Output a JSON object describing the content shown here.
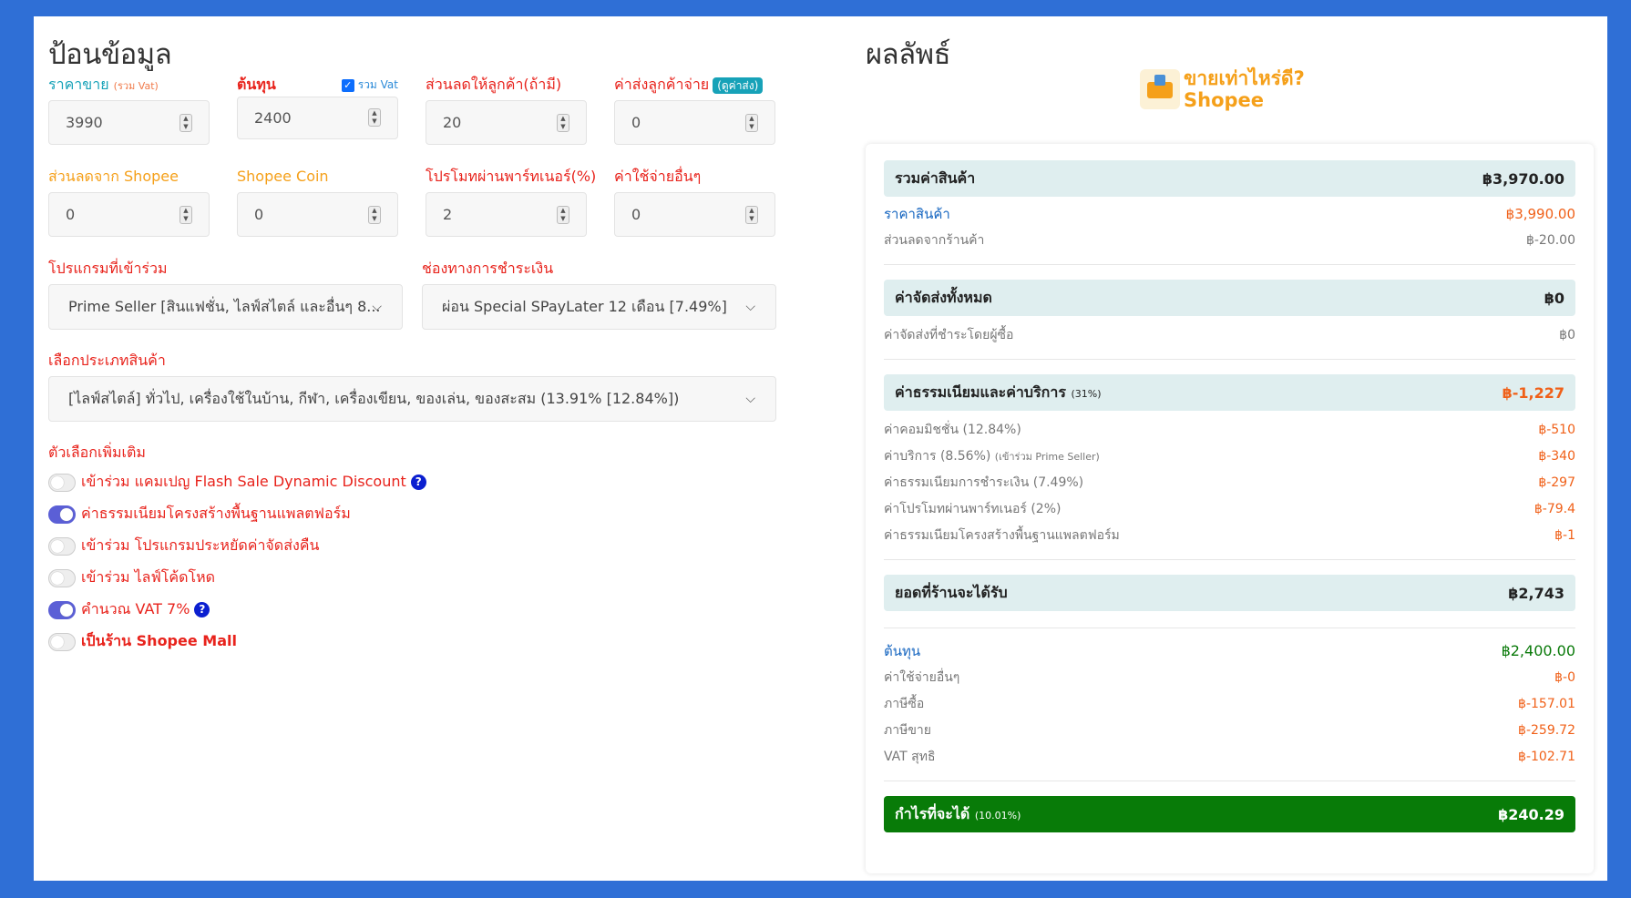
{
  "input": {
    "title": "ป้อนข้อมูล",
    "fields_row1": [
      {
        "label": "ราคาขาย",
        "note": "(รวม Vat)",
        "value": "3990"
      },
      {
        "label": "ต้นทุน",
        "checkbox_label": "รวม Vat",
        "value": "2400"
      },
      {
        "label": "ส่วนลดให้ลูกค้า(ถ้ามี)",
        "value": "20"
      },
      {
        "label": "ค่าส่งลูกค้าจ่าย",
        "pill": "(ดูค่าส่ง)",
        "value": "0"
      }
    ],
    "fields_row2": [
      {
        "label": "ส่วนลดจาก Shopee",
        "value": "0"
      },
      {
        "label": "Shopee Coin",
        "value": "0"
      },
      {
        "label": "โปรโมทผ่านพาร์ทเนอร์(%)",
        "value": "2"
      },
      {
        "label": "ค่าใช้จ่ายอื่นๆ",
        "value": "0"
      }
    ],
    "program": {
      "label": "โปรแกรมที่เข้าร่วม",
      "value": "Prime Seller [สินแฟชั่น, ไลฟ์สไตล์ และอื่นๆ 8..."
    },
    "payment": {
      "label": "ช่องทางการชำระเงิน",
      "value": "ผ่อน Special SPayLater 12 เดือน [7.49%]"
    },
    "category": {
      "label": "เลือกประเภทสินค้า",
      "value": "[ไลฟ์สไตล์] ทั่วไป, เครื่องใช้ในบ้าน, กีฬา, เครื่องเขียน, ของเล่น, ของสะสม (13.91% [12.84%])"
    },
    "options_title": "ตัวเลือกเพิ่มเติม",
    "options": [
      {
        "label": "เข้าร่วม แคมเปญ Flash Sale Dynamic Discount",
        "on": false,
        "help": true
      },
      {
        "label": "ค่าธรรมเนียมโครงสร้างพื้นฐานแพลตฟอร์ม",
        "on": true,
        "help": false
      },
      {
        "label": "เข้าร่วม โปรแกรมประหยัดค่าจัดส่งคืน",
        "on": false,
        "help": false
      },
      {
        "label": "เข้าร่วม ไลฟ์โค้ดโหด",
        "on": false,
        "help": false
      },
      {
        "label": "คำนวณ VAT 7%",
        "on": true,
        "help": true
      },
      {
        "label": "เป็นร้าน Shopee Mall",
        "on": false,
        "help": false
      }
    ]
  },
  "result": {
    "title": "ผลลัพธ์",
    "brand_line1": "ขายเท่าไหร่ดี?",
    "brand_line2": "Shopee",
    "total_products": {
      "label": "รวมค่าสินค้า",
      "value": "฿3,970.00"
    },
    "price": {
      "label": "ราคาสินค้า",
      "value": "฿3,990.00"
    },
    "shop_discount": {
      "label": "ส่วนลดจากร้านค้า",
      "value": "฿-20.00"
    },
    "shipping_total": {
      "label": "ค่าจัดส่งทั้งหมด",
      "value": "฿0"
    },
    "shipping_buyer": {
      "label": "ค่าจัดส่งที่ชำระโดยผู้ซื้อ",
      "value": "฿0"
    },
    "fees": {
      "label": "ค่าธรรมเนียมและค่าบริการ",
      "note": "(31%)",
      "value": "฿-1,227"
    },
    "fee_items": [
      {
        "label": "ค่าคอมมิชชั่น (12.84%)",
        "note": "",
        "value": "฿-510"
      },
      {
        "label": "ค่าบริการ (8.56%)",
        "note": "(เข้าร่วม Prime Seller)",
        "value": "฿-340"
      },
      {
        "label": "ค่าธรรมเนียมการชำระเงิน (7.49%)",
        "note": "",
        "value": "฿-297"
      },
      {
        "label": "ค่าโปรโมทผ่านพาร์ทเนอร์ (2%)",
        "note": "",
        "value": "฿-79.4"
      },
      {
        "label": "ค่าธรรมเนียมโครงสร้างพื้นฐานแพลตฟอร์ม",
        "note": "",
        "value": "฿-1"
      }
    ],
    "shop_receives": {
      "label": "ยอดที่ร้านจะได้รับ",
      "value": "฿2,743"
    },
    "cost": {
      "label": "ต้นทุน",
      "value": "฿2,400.00"
    },
    "cost_items": [
      {
        "label": "ค่าใช้จ่ายอื่นๆ",
        "value": "฿-0"
      },
      {
        "label": "ภาษีซื้อ",
        "value": "฿-157.01"
      },
      {
        "label": "ภาษีขาย",
        "value": "฿-259.72"
      },
      {
        "label": "VAT สุทธิ",
        "value": "฿-102.71"
      }
    ],
    "profit": {
      "label": "กำไรที่จะได้",
      "note": "(10.01%)",
      "value": "฿240.29"
    }
  },
  "colors": {
    "background": "#2f6fd6",
    "label_red": "#e8231c",
    "label_teal": "#17a2b8",
    "label_orange": "#f5a01a",
    "profit_green": "#087b08",
    "negative_orange": "#f06018"
  }
}
